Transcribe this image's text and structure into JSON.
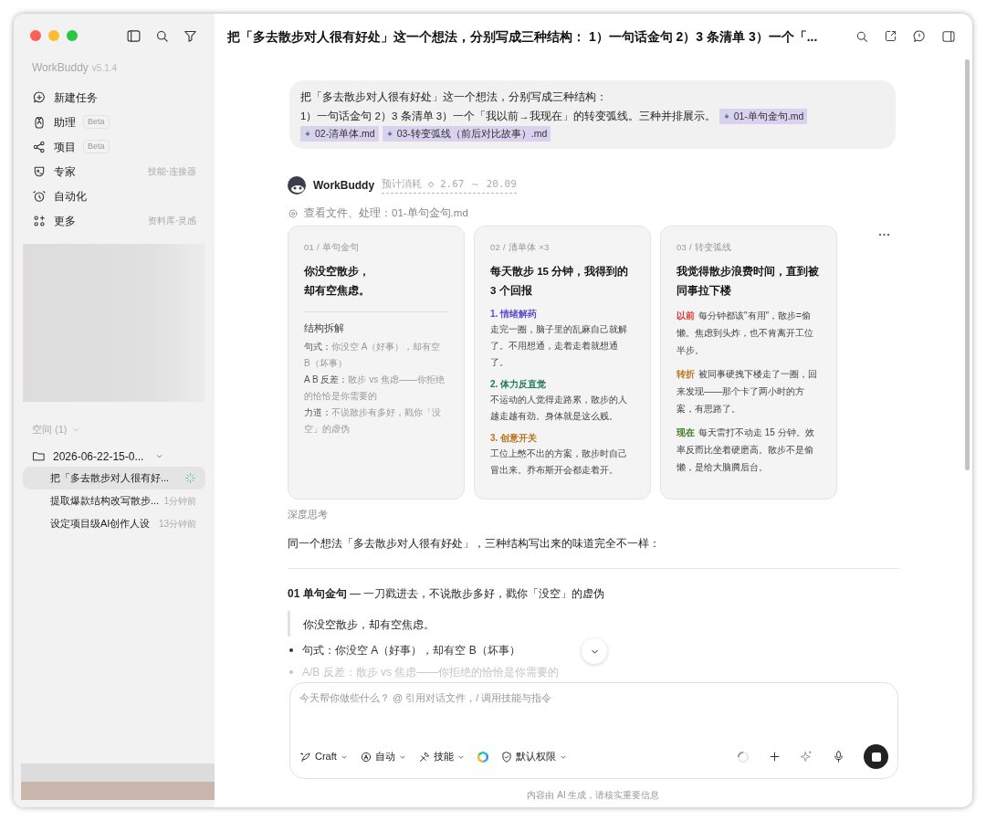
{
  "sidebar": {
    "brand": "WorkBuddy",
    "version": "v5.1.4",
    "nav": [
      {
        "kind": "new",
        "label": "新建任务"
      },
      {
        "kind": "assistant",
        "label": "助理",
        "badge": "Beta"
      },
      {
        "kind": "project",
        "label": "项目",
        "badge": "Beta"
      },
      {
        "kind": "expert",
        "label": "专家",
        "hint": "技能·连接器"
      },
      {
        "kind": "automation",
        "label": "自动化"
      },
      {
        "kind": "more",
        "label": "更多",
        "hint": "资料库·灵感"
      }
    ],
    "space_label": "空间 (1)",
    "folder": {
      "name": "2026-06-22-15-0...",
      "expanded": true,
      "tasks": [
        {
          "title": "把「多去散步对人很有好...",
          "selected": true,
          "running": true
        },
        {
          "title": "提取爆款结构改写散步...",
          "time": "1分钟前",
          "selected": false,
          "running": false
        },
        {
          "title": "设定项目级AI创作人设",
          "time": "13分钟前",
          "selected": false,
          "running": false
        }
      ]
    }
  },
  "header": {
    "title": "把「多去散步对人很有好处」这一个想法，分别写成三种结构： 1）一句话金句 2）3 条清单 3）一个「..."
  },
  "user_message": {
    "lines": [
      "把「多去散步对人很有好处」这一个想法，分别写成三种结构：",
      "1）一句话金句  2）3 条清单  3）一个「我以前→我现在」的转变弧线。三种并排展示。"
    ],
    "attachments": [
      "01-单句金句.md",
      "02-清单体.md",
      "03-转变弧线（前后对比故事）.md"
    ]
  },
  "agent": {
    "name": "WorkBuddy",
    "cost": "预计消耗 ◇ 2.67 ～ 20.09",
    "tool_step": "查看文件、处理：01-单句金句.md"
  },
  "cards": [
    {
      "kind": "quote",
      "label": "01 / 单句金句",
      "title_lines": [
        "你没空散步，",
        "却有空焦虑。"
      ],
      "section": "结构拆解",
      "items": [
        {
          "label": "句式：",
          "text": "你没空 A（好事），却有空 B（坏事）"
        },
        {
          "label": "A B 反差：",
          "text": "散步 vs 焦虑——你拒绝的恰恰是你需要的"
        },
        {
          "label": "力道：",
          "text": "不说散步有多好，戳你「没空」的虚伪"
        }
      ]
    },
    {
      "kind": "list",
      "label": "02 / 清单体 ×3",
      "title_lines": [
        "每天散步 15 分钟，我得到的 3 个回报"
      ],
      "items": [
        {
          "label": "1. 情绪解药",
          "color": "#5b4fc7",
          "text": "走完一圈，脑子里的乱麻自己就解了。不用想通，走着走着就想通了。"
        },
        {
          "label": "2. 体力反直觉",
          "color": "#1f7a5a",
          "text": "不运动的人觉得走路累，散步的人越走越有劲。身体就是这么贱。"
        },
        {
          "label": "3. 创意开关",
          "color": "#b8741a",
          "text": "工位上憋不出的方案，散步时自己冒出来。乔布斯开会都走着开。"
        }
      ]
    },
    {
      "kind": "arc",
      "label": "03 / 转变弧线",
      "title_lines": [
        "我觉得散步浪费时间，直到被同事拉下楼"
      ],
      "items": [
        {
          "label": "以前",
          "color": "#d93a3a",
          "text": "每分钟都该\"有用\"，散步=偷懒。焦虑到头炸，也不肯离开工位半步。"
        },
        {
          "label": "转折",
          "color": "#b8741a",
          "text": "被同事硬拽下楼走了一圈，回来发现——那个卡了两小时的方案，有思路了。"
        },
        {
          "label": "现在",
          "color": "#3f7a1a",
          "text": "每天雷打不动走 15 分钟。效率反而比坐着硬磨高。散步不是偷懒，是给大脑腾后台。"
        }
      ]
    }
  ],
  "thinking_label": "深度思考",
  "answer": {
    "intro": "同一个想法「多去散步对人很有好处」，三种结构写出来的味道完全不一样：",
    "heading": "**01 单句金句** — 一刀戳进去，不说散步多好，戳你「没空」的虚伪",
    "quote": "你没空散步，却有空焦虑。",
    "bullets": [
      {
        "text": "句式：你没空 A（好事），却有空 B（坏事）",
        "faded": false
      },
      {
        "text": "A/B 反差：散步 vs 焦虑——你拒绝的恰恰是你需要的",
        "faded": true
      }
    ]
  },
  "composer": {
    "placeholder": "今天帮你做些什么？ @ 引用对话文件，/ 调用技能与指令",
    "tools": [
      {
        "kind": "craft",
        "label": "Craft"
      },
      {
        "kind": "auto",
        "label": "自动"
      },
      {
        "kind": "skill",
        "label": "技能"
      },
      {
        "kind": "logo"
      },
      {
        "kind": "permission",
        "label": "默认权限"
      }
    ],
    "generating": true
  },
  "footer": "内容由 AI 生成，请核实重要信息"
}
